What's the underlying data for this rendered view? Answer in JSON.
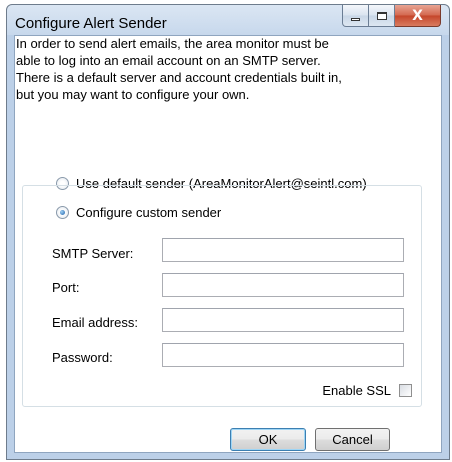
{
  "window": {
    "title": "Configure Alert Sender",
    "caption_buttons": {
      "minimize_icon": "minimize-icon",
      "maximize_icon": "maximize-icon",
      "close_icon": "close-icon",
      "close_glyph": "X"
    }
  },
  "intro": {
    "lines": [
      "In order to send alert emails, the area monitor must be",
      "able to log into an email account on an SMTP server.",
      "There is a default server and account credentials built in,",
      "but you may want to configure your own."
    ]
  },
  "sender_options": {
    "default_label": "Use default sender (AreaMonitorAlert@seintl.com)",
    "default_selected": false,
    "custom_label": "Configure custom sender",
    "custom_selected": true
  },
  "form": {
    "smtp_server": {
      "label": "SMTP Server:",
      "value": ""
    },
    "port": {
      "label": "Port:",
      "value": ""
    },
    "email_address": {
      "label": "Email address:",
      "value": ""
    },
    "password": {
      "label": "Password:",
      "value": ""
    },
    "enable_ssl": {
      "label": "Enable SSL",
      "checked": false
    }
  },
  "buttons": {
    "ok": "OK",
    "cancel": "Cancel"
  },
  "colors": {
    "title_bar": "#c7d8ec",
    "close_button": "#c4452a",
    "default_button_border": "#3c7fb1"
  }
}
